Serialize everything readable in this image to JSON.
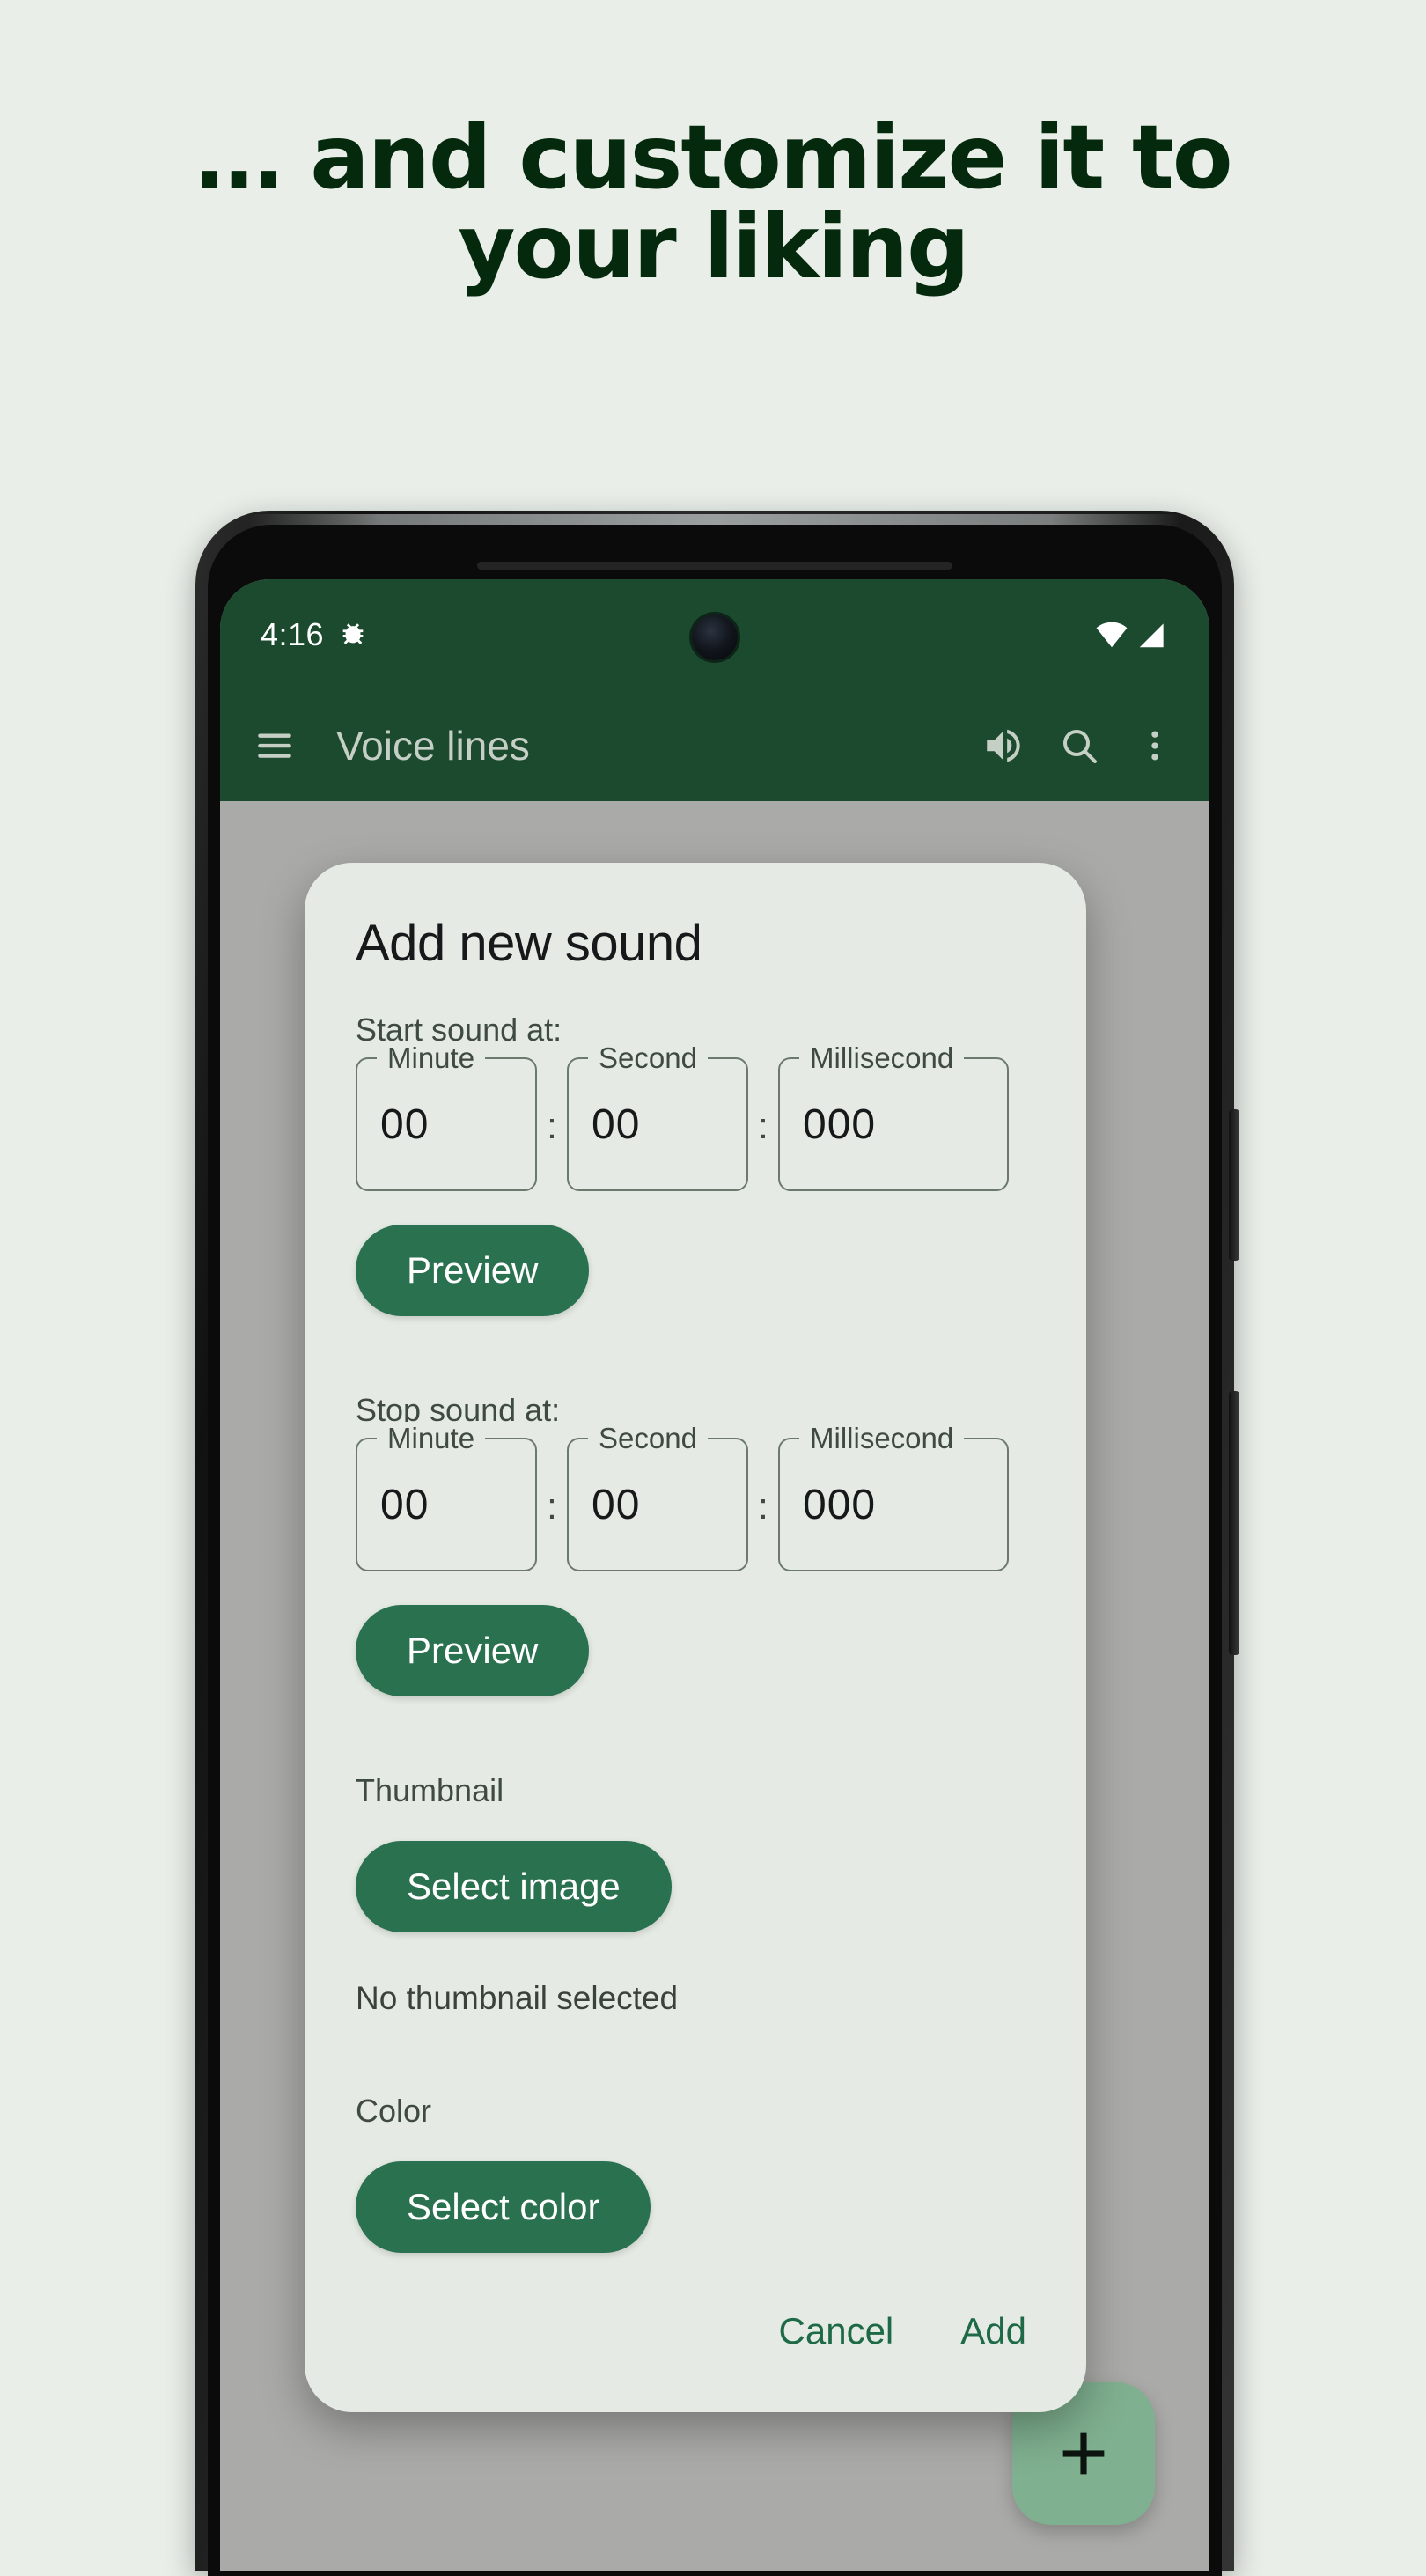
{
  "promo": {
    "headline": "… and customize it to\nyour liking",
    "headline_color": "#05290c",
    "background_color": "#e9eee8"
  },
  "phone": {
    "status_bar": {
      "time": "4:16",
      "icons": [
        "bug-icon",
        "wifi-icon",
        "signal-icon"
      ],
      "background_color": "#1b4a2e"
    },
    "app_bar": {
      "title": "Voice lines",
      "menu_icon": "hamburger-menu-icon",
      "volume_icon": "volume-up-icon",
      "search_icon": "search-icon",
      "overflow_icon": "more-vertical-icon",
      "background_color": "#1b4a2e",
      "title_color": "#c6cfc6"
    },
    "fab": {
      "icon": "plus-icon",
      "color": "#7fb08f"
    }
  },
  "dialog": {
    "title": "Add new sound",
    "background_color": "#e5ebe4",
    "accent_color": "#2a7150",
    "start_section": {
      "label": "Start sound at:",
      "fields": [
        {
          "label": "Minute",
          "value": "00"
        },
        {
          "label": "Second",
          "value": "00"
        },
        {
          "label": "Millisecond",
          "value": "000"
        }
      ],
      "separator": ":",
      "preview_label": "Preview"
    },
    "stop_section": {
      "label": "Stop sound at:",
      "fields": [
        {
          "label": "Minute",
          "value": "00"
        },
        {
          "label": "Second",
          "value": "00"
        },
        {
          "label": "Millisecond",
          "value": "000"
        }
      ],
      "separator": ":",
      "preview_label": "Preview"
    },
    "thumbnail_section": {
      "label": "Thumbnail",
      "button_label": "Select image",
      "status_text": "No thumbnail selected"
    },
    "color_section": {
      "label": "Color",
      "button_label": "Select color"
    },
    "actions": {
      "cancel_label": "Cancel",
      "add_label": "Add"
    }
  }
}
